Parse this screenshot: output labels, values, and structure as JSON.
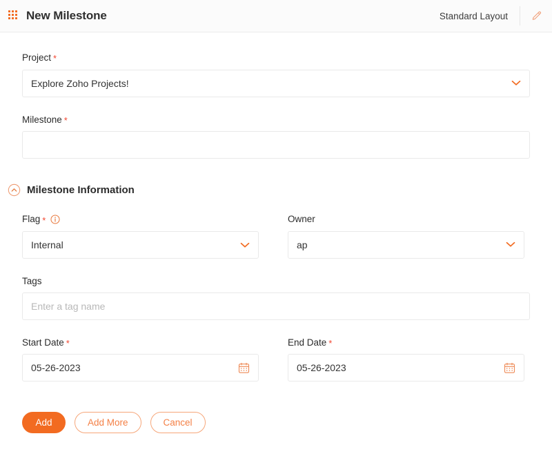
{
  "header": {
    "title": "New Milestone",
    "layout_label": "Standard Layout",
    "grid_icon": "apps-grid-icon",
    "edit_icon": "pencil-edit-icon"
  },
  "form": {
    "project": {
      "label": "Project",
      "required": "*",
      "value": "Explore Zoho Projects!",
      "chevron_icon": "chevron-down-icon"
    },
    "milestone": {
      "label": "Milestone",
      "required": "*",
      "value": "",
      "placeholder": ""
    },
    "section": {
      "title": "Milestone Information",
      "collapse_icon": "chevron-up-circle-icon"
    },
    "flag": {
      "label": "Flag",
      "required": "*",
      "info_icon": "info-circle-icon",
      "value": "Internal",
      "chevron_icon": "chevron-down-icon"
    },
    "owner": {
      "label": "Owner",
      "value": "ap",
      "chevron_icon": "chevron-down-icon"
    },
    "tags": {
      "label": "Tags",
      "value": "",
      "placeholder": "Enter a tag name"
    },
    "start_date": {
      "label": "Start Date",
      "required": "*",
      "value": "05-26-2023",
      "calendar_icon": "calendar-icon"
    },
    "end_date": {
      "label": "End Date",
      "required": "*",
      "value": "05-26-2023",
      "calendar_icon": "calendar-icon"
    }
  },
  "actions": {
    "add": "Add",
    "add_more": "Add More",
    "cancel": "Cancel"
  },
  "colors": {
    "accent": "#F26B21",
    "accent_light": "#F6A679",
    "required_red": "#F2452F",
    "text": "#2B2B2B",
    "placeholder": "#B8B8B8",
    "border": "#E9E9E9",
    "header_bg": "#FBFBFB"
  }
}
